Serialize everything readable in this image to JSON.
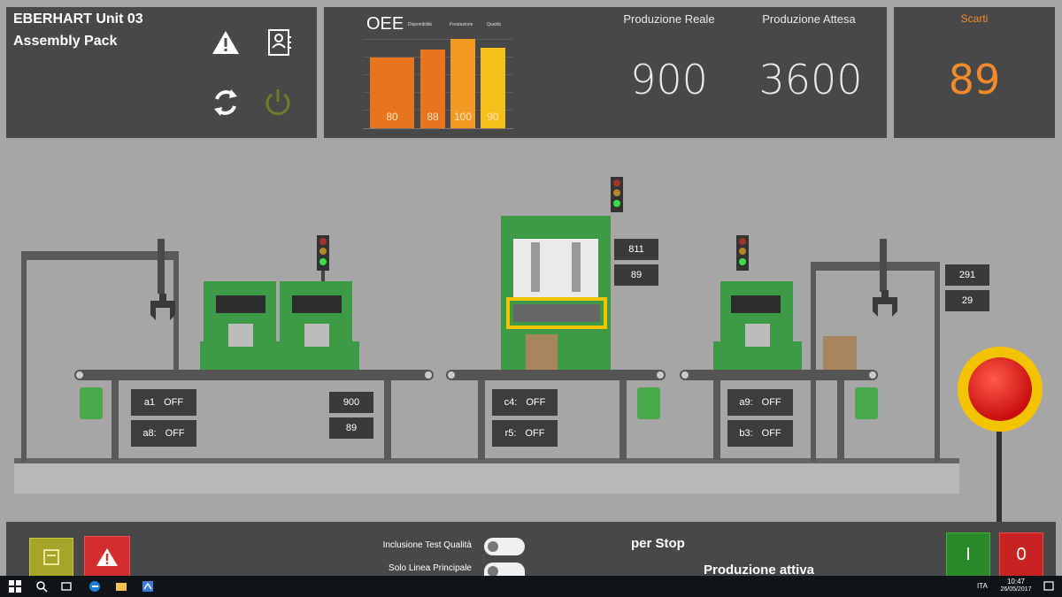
{
  "header": {
    "line1": "EBERHART  Unit 03",
    "line2": "Assembly Pack"
  },
  "oee": {
    "title": "OEE",
    "legend": [
      "Disponibilità",
      "Prestazione",
      "Qualità"
    ],
    "bars": [
      80,
      88,
      100,
      90
    ],
    "colors": [
      "#e8741e",
      "#e8741e",
      "#f39a24",
      "#f5c01a"
    ]
  },
  "production": {
    "real_label": "Produzione Reale",
    "real_value": "900",
    "expected_label": "Produzione Attesa",
    "expected_value": "3600"
  },
  "scrap": {
    "label": "Scarti",
    "value": "89"
  },
  "counters": {
    "left_top": "900",
    "left_bottom": "89",
    "center_top": "811",
    "center_bottom": "89",
    "right_top": "291",
    "right_bottom": "29"
  },
  "sensors": {
    "a1": {
      "name": "a1",
      "state": "OFF"
    },
    "a8": {
      "name": "a8:",
      "state": "OFF"
    },
    "c4": {
      "name": "c4:",
      "state": "OFF"
    },
    "r5": {
      "name": "r5:",
      "state": "OFF"
    },
    "a9": {
      "name": "a9:",
      "state": "OFF"
    },
    "b3": {
      "name": "b3:",
      "state": "OFF"
    }
  },
  "bottom": {
    "toggle1_label": "Inclusione Test Qualità",
    "toggle2_label": "Solo Linea Principale",
    "stop_text": "per Stop",
    "status_text": "Produzione attiva",
    "start_label": "I",
    "stop_label": "0"
  },
  "taskbar": {
    "lang": "ITA",
    "time": "10:47",
    "date": "26/05/2017"
  },
  "colors": {
    "machine_green": "#3f9a45",
    "accent_orange": "#f08a2a",
    "estop_red": "#d81b1b",
    "estop_ring": "#f4c400"
  }
}
